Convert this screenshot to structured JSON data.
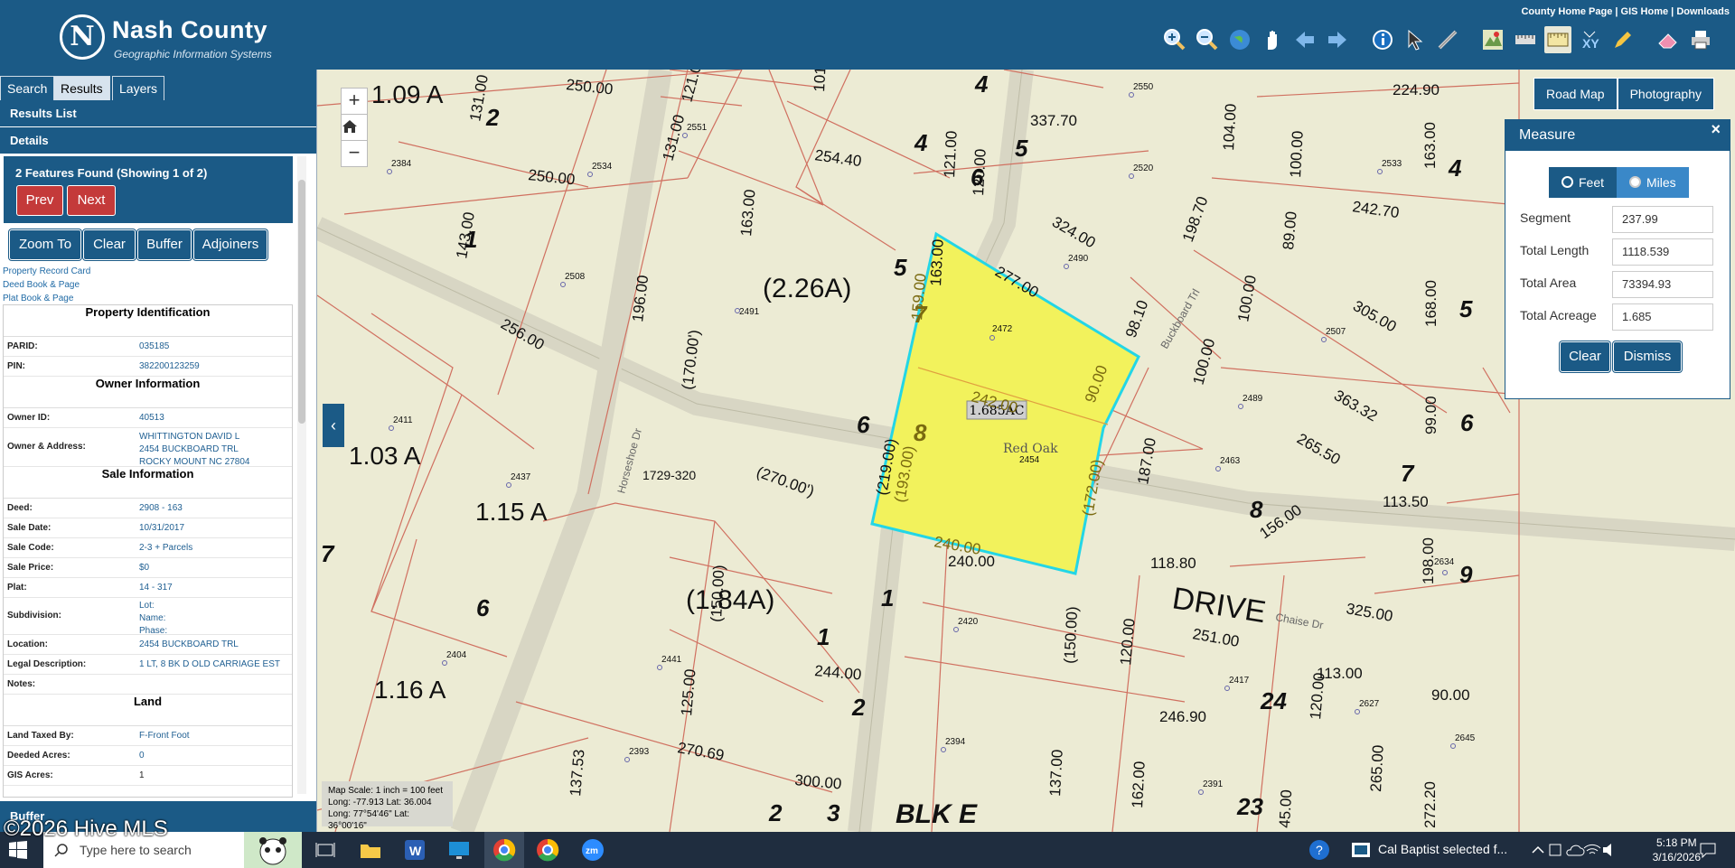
{
  "header": {
    "title": "Nash County",
    "subtitle": "Geographic Information Systems",
    "logo_letter": "N",
    "links": [
      "County Home Page",
      "GIS Home",
      "Downloads"
    ],
    "toolbar": [
      "zoom-in",
      "zoom-out",
      "globe",
      "pan",
      "back",
      "forward",
      "identify",
      "select",
      "draw",
      "map-print",
      "measure-tape",
      "measure",
      "xy",
      "pencil",
      "eraser",
      "print"
    ]
  },
  "left": {
    "tabs": [
      "Search",
      "Results",
      "Layers"
    ],
    "results_list": "Results List",
    "details": "Details",
    "found_text": "2 Features Found (Showing 1 of 2)",
    "prev": "Prev",
    "next": "Next",
    "actions": [
      "Zoom To",
      "Clear",
      "Buffer",
      "Adjoiners"
    ],
    "links": [
      "Property Record Card",
      "Deed Book & Page",
      "Plat Book & Page"
    ],
    "property_identification": "Property Identification",
    "parid_label": "PARID:",
    "parid": "035185",
    "pin_label": "PIN:",
    "pin": "382200123259",
    "owner_info": "Owner Information",
    "owner_id_label": "Owner ID:",
    "owner_id": "40513",
    "owner_addr_label": "Owner & Address:",
    "owner_addr": [
      "WHITTINGTON DAVID L",
      "2454 BUCKBOARD TRL",
      "ROCKY MOUNT NC 27804"
    ],
    "sale_info": "Sale Information",
    "deed_label": "Deed:",
    "deed": "2908 - 163",
    "sale_date_label": "Sale Date:",
    "sale_date": "10/31/2017",
    "sale_code_label": "Sale Code:",
    "sale_code": "2-3 + Parcels",
    "sale_price_label": "Sale Price:",
    "sale_price": "$0",
    "plat_label": "Plat:",
    "plat": "14 - 317",
    "subdivision_label": "Subdivision:",
    "subdivision": [
      "Lot:",
      "Name:",
      "Phase:"
    ],
    "location_label": "Location:",
    "location": "2454 BUCKBOARD TRL",
    "legal_label": "Legal Description:",
    "legal": "1 LT, 8 BK D OLD CARRIAGE EST",
    "notes_label": "Notes:",
    "land": "Land",
    "land_taxed_label": "Land Taxed By:",
    "land_taxed": "F-Front Foot",
    "deeded_label": "Deeded Acres:",
    "deeded": "0",
    "gis_label": "GIS Acres:",
    "gis": "1",
    "buffer": "Buffer",
    "watermark": "©2026 Hive MLS"
  },
  "map": {
    "basemaps": [
      "Road Map",
      "Photography"
    ],
    "scale_text": [
      "Map Scale: 1 inch = 100 feet",
      "Long: -77.913 Lat: 36.004",
      "Long: 77°54'46\" Lat: 36°00'16\""
    ],
    "parcel_label": "1.685AC",
    "labels": {
      "l1": "1.09 A",
      "l2": "1.03 A",
      "l3": "1.15 A",
      "l4": "1.16 A",
      "l5": "(2.26A)",
      "l6": "(1.84A)",
      "drive": "DRIVE",
      "blk": "BLK E",
      "red_oak": "Red Oak",
      "parcel_id": "1729-320",
      "horseshoe": "Horseshoe Dr",
      "buckboard": "Buckboard Trl",
      "chaise": "Chaise Dr"
    }
  },
  "measure": {
    "title": "Measure",
    "close": "×",
    "feet": "Feet",
    "miles": "Miles",
    "segment_label": "Segment",
    "segment": "237.99",
    "total_length_label": "Total Length",
    "total_length": "1118.539",
    "total_area_label": "Total Area",
    "total_area": "73394.93",
    "total_acreage_label": "Total Acreage",
    "total_acreage": "1.685",
    "clear": "Clear",
    "dismiss": "Dismiss"
  },
  "taskbar": {
    "search_placeholder": "Type here to search",
    "notification": "Cal Baptist selected f...",
    "time": "5:18 PM",
    "date": "3/16/2026"
  },
  "colors": {
    "brand": "#1b5a86",
    "parcel_fill": "#f2f25c",
    "parcel_outline": "#23d6e6",
    "lot_lines": "#d07060",
    "map_bg": "#ecebd4",
    "prev_next": "#c43a3a"
  }
}
